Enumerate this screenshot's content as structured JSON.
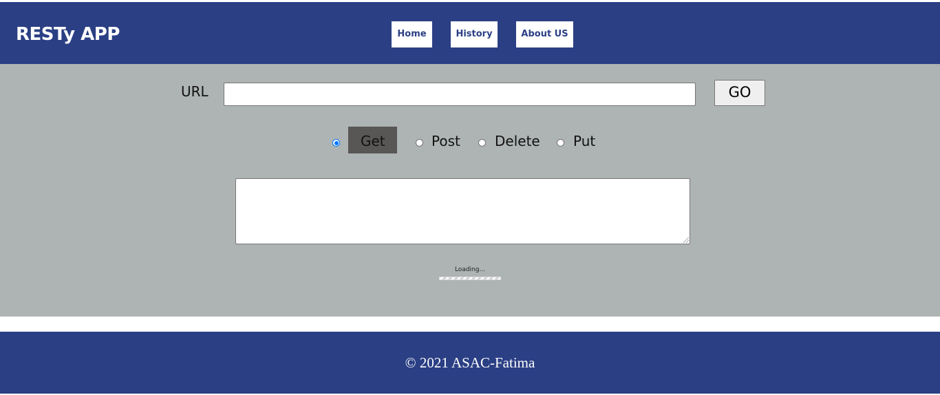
{
  "header": {
    "brand": "RESTy APP",
    "nav": [
      {
        "label": "Home"
      },
      {
        "label": "History"
      },
      {
        "label": "About US"
      }
    ]
  },
  "form": {
    "url_label": "URL",
    "url_value": "",
    "go_label": "GO",
    "methods": [
      {
        "label": "Get",
        "selected": true
      },
      {
        "label": "Post",
        "selected": false
      },
      {
        "label": "Delete",
        "selected": false
      },
      {
        "label": "Put",
        "selected": false
      }
    ],
    "body_value": ""
  },
  "status": {
    "loading_text": "Loading..."
  },
  "footer": {
    "copyright": "© 2021 ASAC-Fatima"
  },
  "colors": {
    "header_bg": "#2b3f84",
    "main_bg": "#aeb4b3",
    "selected_method_bg": "#585755"
  }
}
